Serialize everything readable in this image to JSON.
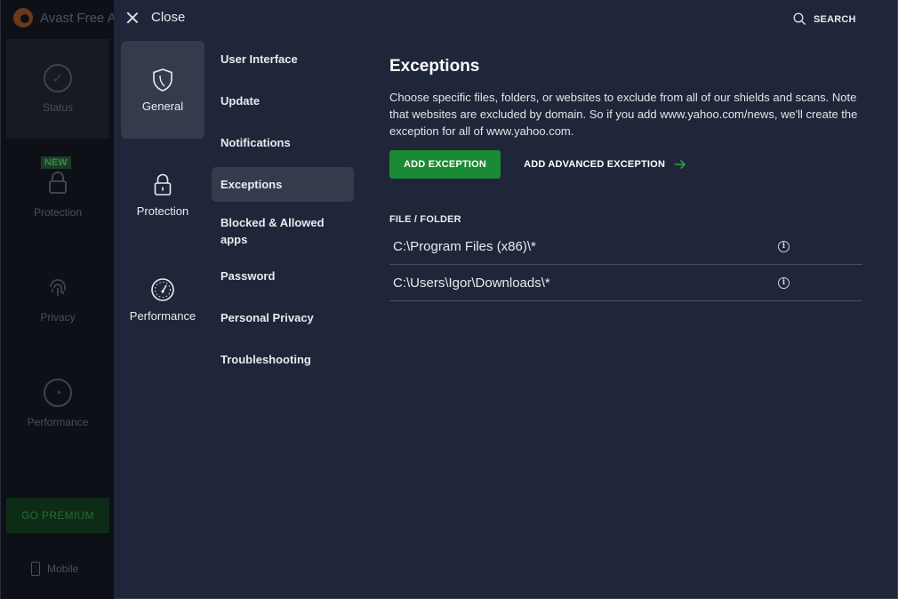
{
  "background_app": {
    "title": "Avast Free A",
    "nav": [
      {
        "label": "Status",
        "icon": "check-circle-icon"
      },
      {
        "label": "Protection",
        "icon": "lock-icon",
        "badge": "NEW"
      },
      {
        "label": "Privacy",
        "icon": "fingerprint-icon"
      },
      {
        "label": "Performance",
        "icon": "gauge-icon"
      }
    ],
    "premium_label": "GO PREMIUM",
    "mobile_label": "Mobile"
  },
  "header": {
    "close_label": "Close",
    "search_label": "SEARCH"
  },
  "categories": [
    {
      "label": "General",
      "icon": "shield-icon",
      "active": true
    },
    {
      "label": "Protection",
      "icon": "lock-icon",
      "active": false
    },
    {
      "label": "Performance",
      "icon": "speedometer-icon",
      "active": false
    }
  ],
  "subnav": [
    {
      "label": "User Interface"
    },
    {
      "label": "Update"
    },
    {
      "label": "Notifications"
    },
    {
      "label": "Exceptions",
      "active": true
    },
    {
      "label": "Blocked & Allowed apps"
    },
    {
      "label": "Password"
    },
    {
      "label": "Personal Privacy"
    },
    {
      "label": "Troubleshooting"
    }
  ],
  "main": {
    "title": "Exceptions",
    "description": "Choose specific files, folders, or websites to exclude from all of our shields and scans. Note that websites are excluded by domain. So if you add www.yahoo.com/news, we'll create the exception for all of www.yahoo.com.",
    "add_exception_label": "ADD EXCEPTION",
    "add_advanced_label": "ADD ADVANCED EXCEPTION",
    "column_header": "FILE / FOLDER",
    "exceptions": [
      {
        "path": "C:\\Program Files (x86)\\*"
      },
      {
        "path": "C:\\Users\\Igor\\Downloads\\*"
      }
    ]
  },
  "colors": {
    "overlay_bg": "#202639",
    "accent_green": "#1b8a35",
    "active_item_bg": "#353b4c"
  }
}
